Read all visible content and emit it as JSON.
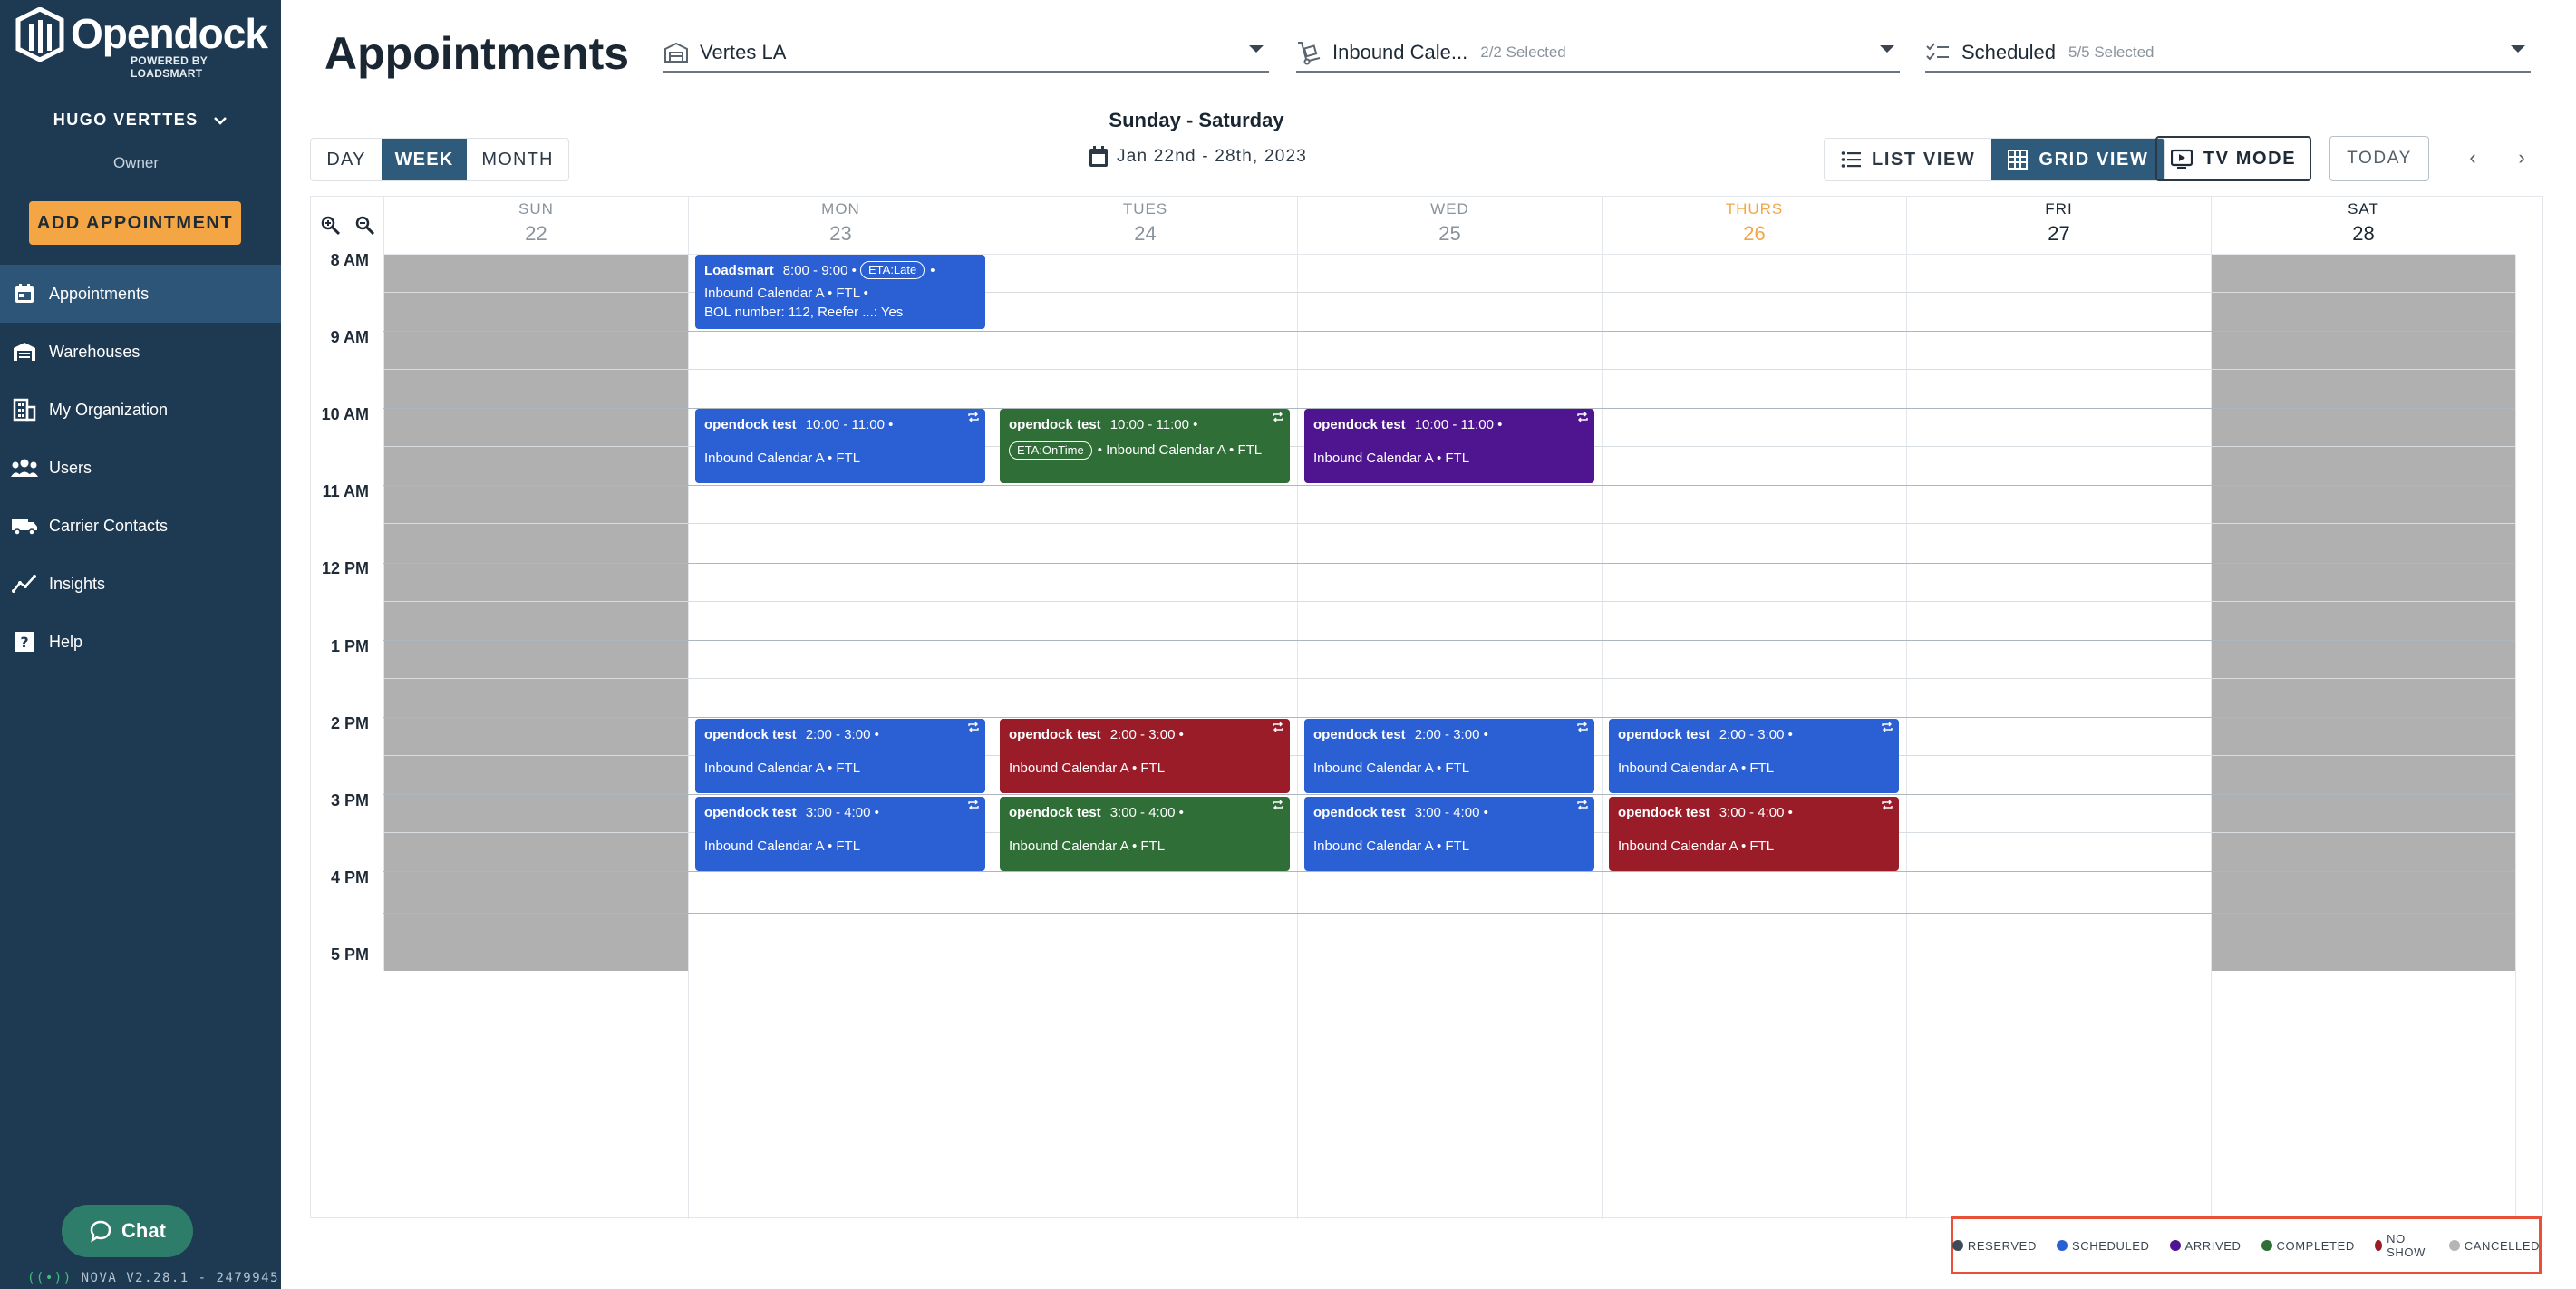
{
  "brand": {
    "name": "Opendock",
    "subtitle": "POWERED BY LOADSMART"
  },
  "user": {
    "name": "HUGO VERTTES",
    "role": "Owner"
  },
  "sidebar": {
    "add_button": "ADD APPOINTMENT",
    "items": [
      {
        "label": "Appointments",
        "icon": "calendar-icon",
        "active": true
      },
      {
        "label": "Warehouses",
        "icon": "warehouse-icon"
      },
      {
        "label": "My Organization",
        "icon": "building-icon"
      },
      {
        "label": "Users",
        "icon": "users-icon"
      },
      {
        "label": "Carrier Contacts",
        "icon": "truck-icon"
      },
      {
        "label": "Insights",
        "icon": "chart-icon"
      },
      {
        "label": "Help",
        "icon": "help-icon"
      }
    ],
    "chat_label": "Chat",
    "version": "NOVA V2.28.1 - 2479945"
  },
  "header": {
    "title": "Appointments",
    "warehouse_filter": {
      "value": "Vertes LA"
    },
    "calendar_filter": {
      "value": "Inbound Cale...",
      "sub": "2/2 Selected"
    },
    "status_filter": {
      "value": "Scheduled",
      "sub": "5/5 Selected"
    }
  },
  "toolbar": {
    "range_tabs": [
      "DAY",
      "WEEK",
      "MONTH"
    ],
    "active_range": "WEEK",
    "period_title": "Sunday - Saturday",
    "period_range": "Jan 22nd - 28th, 2023",
    "list_view": "LIST VIEW",
    "grid_view": "GRID VIEW",
    "tv_mode": "TV MODE",
    "today": "TODAY",
    "prev": "‹",
    "next": "›"
  },
  "calendar": {
    "days": [
      {
        "name": "SUN",
        "num": "22"
      },
      {
        "name": "MON",
        "num": "23"
      },
      {
        "name": "TUES",
        "num": "24"
      },
      {
        "name": "WED",
        "num": "25"
      },
      {
        "name": "THURS",
        "num": "26"
      },
      {
        "name": "FRI",
        "num": "27"
      },
      {
        "name": "SAT",
        "num": "28"
      }
    ],
    "hours": [
      "8 AM",
      "9 AM",
      "10 AM",
      "11 AM",
      "12 PM",
      "1 PM",
      "2 PM",
      "3 PM",
      "4 PM",
      "5 PM"
    ],
    "appointments": [
      {
        "title": "Loadsmart",
        "time": "8:00 - 9:00 •",
        "pill": "ETA:Late",
        "after_pill": "•",
        "line2": "Inbound Calendar A • FTL •",
        "line3": "BOL number: 112, Reefer ...: Yes",
        "status": "scheduled"
      },
      {
        "title": "opendock test",
        "time": "10:00 - 11:00 •",
        "line2": "Inbound Calendar A • FTL",
        "status": "scheduled"
      },
      {
        "title": "opendock test",
        "time": "10:00 - 11:00 •",
        "pill": "ETA:OnTime",
        "line2": "• Inbound Calendar A • FTL",
        "status": "completed"
      },
      {
        "title": "opendock test",
        "time": "10:00 - 11:00 •",
        "line2": "Inbound Calendar A • FTL",
        "status": "arrived"
      },
      {
        "title": "opendock test",
        "time": "2:00 - 3:00 •",
        "line2": "Inbound Calendar A • FTL",
        "status": "scheduled"
      },
      {
        "title": "opendock test",
        "time": "2:00 - 3:00 •",
        "line2": "Inbound Calendar A • FTL",
        "status": "noshow"
      },
      {
        "title": "opendock test",
        "time": "2:00 - 3:00 •",
        "line2": "Inbound Calendar A • FTL",
        "status": "scheduled"
      },
      {
        "title": "opendock test",
        "time": "2:00 - 3:00 •",
        "line2": "Inbound Calendar A • FTL",
        "status": "scheduled"
      },
      {
        "title": "opendock test",
        "time": "3:00 - 4:00 •",
        "line2": "Inbound Calendar A • FTL",
        "status": "scheduled"
      },
      {
        "title": "opendock test",
        "time": "3:00 - 4:00 •",
        "line2": "Inbound Calendar A • FTL",
        "status": "completed"
      },
      {
        "title": "opendock test",
        "time": "3:00 - 4:00 •",
        "line2": "Inbound Calendar A • FTL",
        "status": "scheduled"
      },
      {
        "title": "opendock test",
        "time": "3:00 - 4:00 •",
        "line2": "Inbound Calendar A • FTL",
        "status": "noshow"
      }
    ]
  },
  "legend": [
    {
      "label": "RESERVED",
      "color": "#3d4a57"
    },
    {
      "label": "SCHEDULED",
      "color": "#2b5fd4"
    },
    {
      "label": "ARRIVED",
      "color": "#4f1490"
    },
    {
      "label": "COMPLETED",
      "color": "#2f6e36"
    },
    {
      "label": "NO SHOW",
      "color": "#9b1c29"
    },
    {
      "label": "CANCELLED",
      "color": "#b5b5b5"
    }
  ],
  "colors": {
    "sidebar": "#1e3a52",
    "accent": "#f4a644",
    "active_tab": "#2e5a7c",
    "closed_day": "#b0b0b0",
    "legend_highlight": "#e8503a"
  }
}
